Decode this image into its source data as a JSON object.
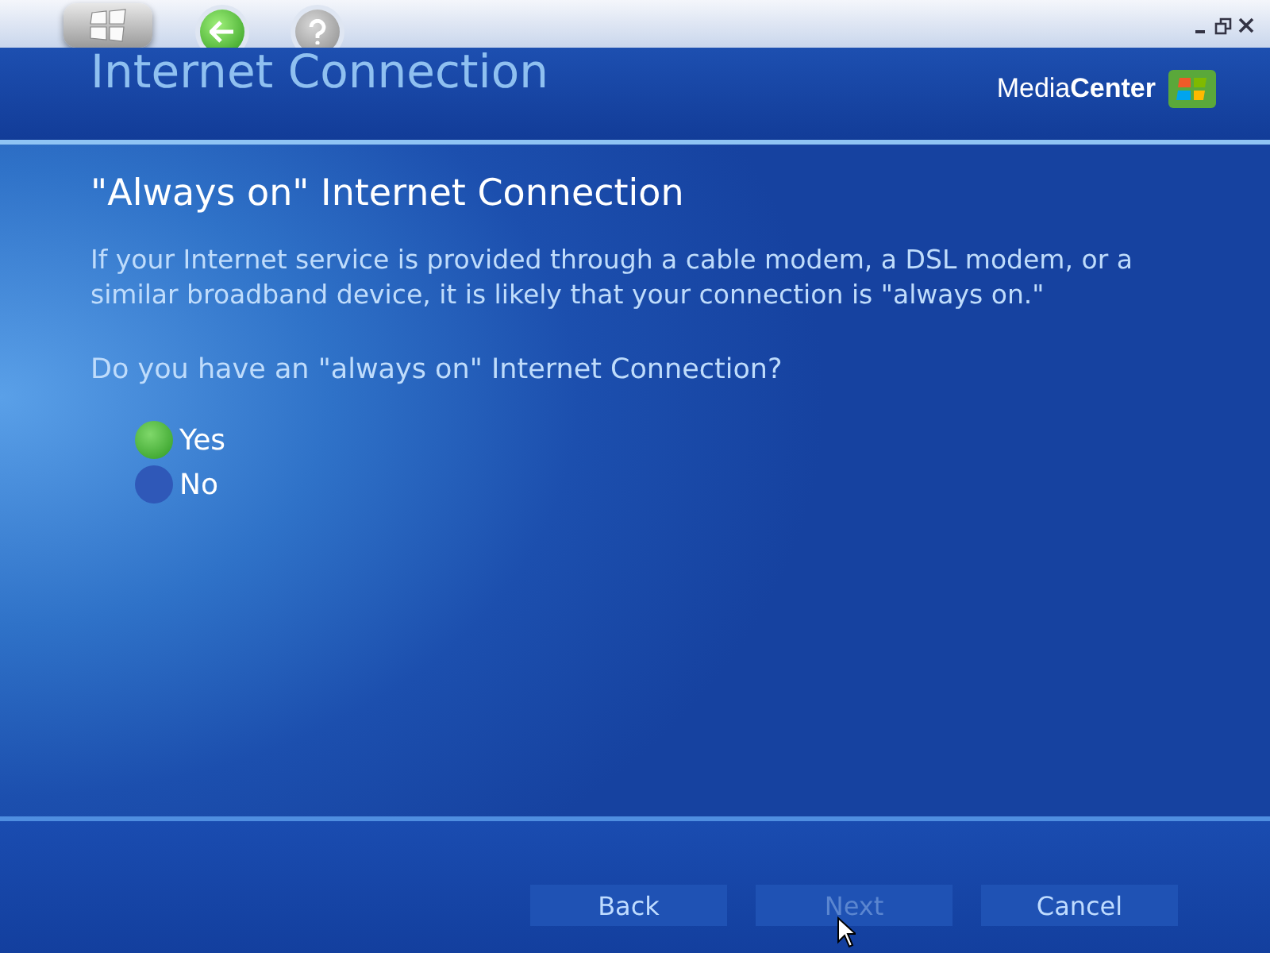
{
  "header": {
    "title": "Internet Connection",
    "brand": "Media**Center**"
  },
  "page": {
    "heading": "\"Always on\" Internet Connection",
    "description": "If your Internet service is provided through a cable modem, a DSL modem, or a similar broadband device, it is likely that your connection is \"always on.\"",
    "question": "Do you have an \"always on\" Internet Connection?"
  },
  "options": [
    {
      "label": "Yes",
      "selected": true
    },
    {
      "label": "No",
      "selected": false
    }
  ],
  "buttons": [
    {
      "label": "Back",
      "disabled": false
    },
    {
      "label": "Next",
      "disabled": true
    },
    {
      "label": "Cancel",
      "disabled": false
    }
  ]
}
